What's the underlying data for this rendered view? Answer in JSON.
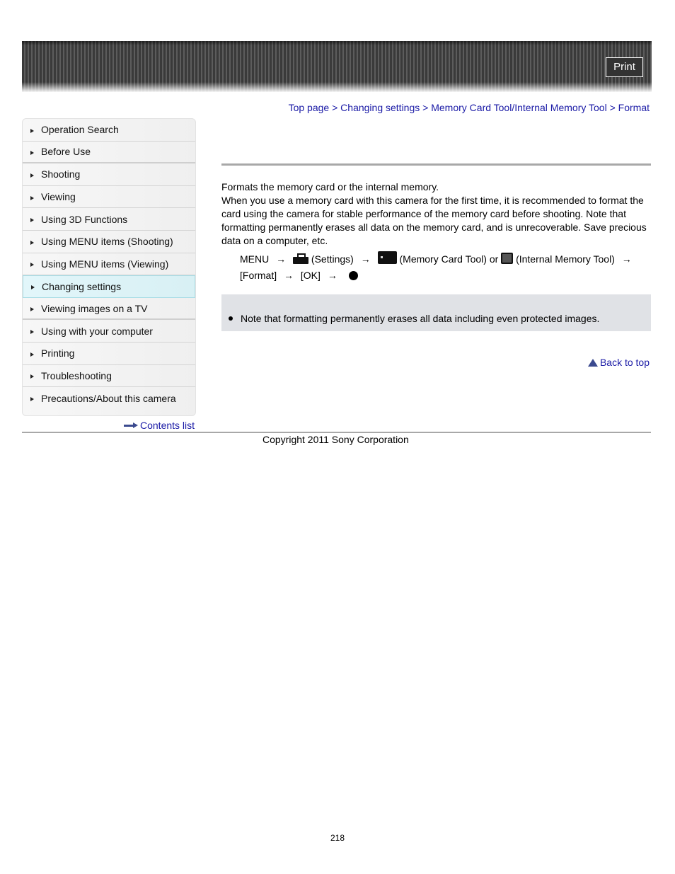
{
  "header": {
    "print_label": "Print"
  },
  "breadcrumb": {
    "items": [
      "Top page",
      "Changing settings",
      "Memory Card Tool/Internal Memory Tool",
      "Format"
    ],
    "separator": ">"
  },
  "sidebar": {
    "items": [
      {
        "label": "Operation Search"
      },
      {
        "label": "Before Use"
      },
      {
        "label": "Shooting"
      },
      {
        "label": "Viewing"
      },
      {
        "label": "Using 3D Functions"
      },
      {
        "label": "Using MENU items (Shooting)"
      },
      {
        "label": "Using MENU items (Viewing)"
      },
      {
        "label": "Changing settings",
        "active": true
      },
      {
        "label": "Viewing images on a TV"
      },
      {
        "label": "Using with your computer"
      },
      {
        "label": "Printing"
      },
      {
        "label": "Troubleshooting"
      },
      {
        "label": "Precautions/About this camera"
      }
    ],
    "contents_link": "Contents list"
  },
  "content": {
    "intro": "Formats the memory card or the internal memory.",
    "body": "When you use a memory card with this camera for the first time, it is recommended to format the card using the camera for stable performance of the memory card before shooting. Note that formatting permanently erases all data on the memory card, and is unrecoverable. Save precious data on a computer, etc.",
    "steps": {
      "menu": "MENU",
      "settings": "(Settings)",
      "memory_card_tool": "(Memory Card Tool) or",
      "internal_memory_tool": "(Internal Memory Tool)",
      "format": "[Format]",
      "ok": "[OK]",
      "arrow": "→",
      "icons": [
        "settings-toolbox-icon",
        "memory-card-icon",
        "internal-memory-icon",
        "center-button-dot-icon"
      ]
    },
    "note": "Note that formatting permanently erases all data including even protected images."
  },
  "back_to_top": "Back to top",
  "footer": {
    "copyright": "Copyright 2011 Sony Corporation"
  },
  "page_number": "218"
}
